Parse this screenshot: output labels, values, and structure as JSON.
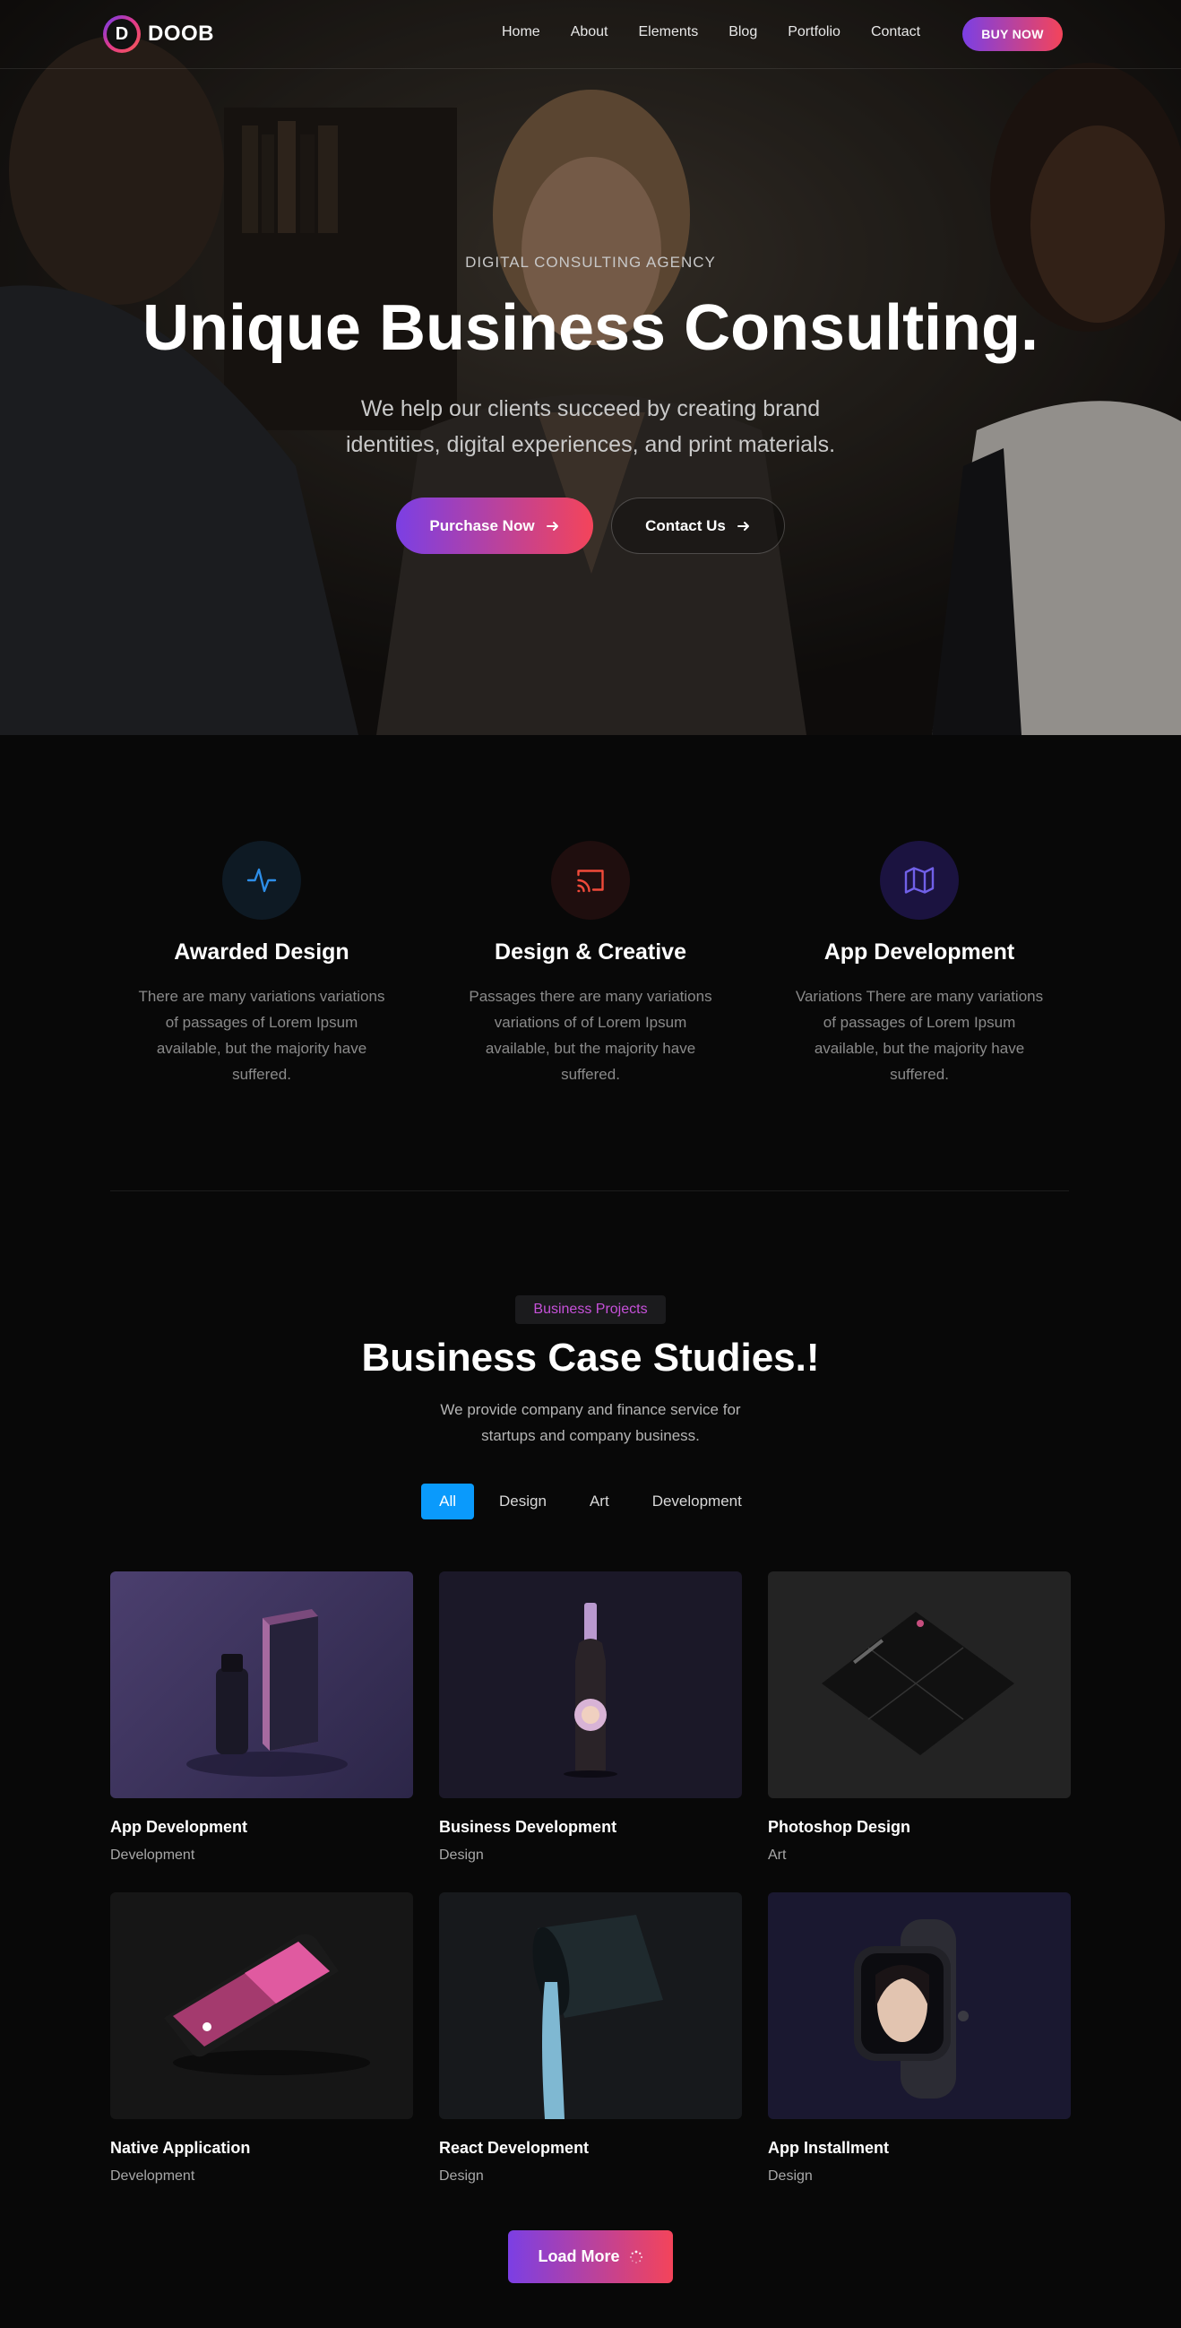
{
  "brand": {
    "logo_letter": "D",
    "name": "DOOB"
  },
  "nav": {
    "items": [
      "Home",
      "About",
      "Elements",
      "Blog",
      "Portfolio",
      "Contact"
    ],
    "cta": "BUY NOW"
  },
  "hero": {
    "subtitle": "DIGITAL CONSULTING AGENCY",
    "title": "Unique Business Consulting.",
    "description": "We help our clients succeed by creating brand identities, digital experiences, and print materials.",
    "primary_button": "Purchase Now",
    "secondary_button": "Contact Us"
  },
  "services": [
    {
      "icon": "activity-icon",
      "title": "Awarded Design",
      "text": "There are many variations variations of passages of Lorem Ipsum available, but the majority have suffered."
    },
    {
      "icon": "cast-icon",
      "title": "Design & Creative",
      "text": "Passages there are many variations variations of of Lorem Ipsum available, but the majority have suffered."
    },
    {
      "icon": "map-icon",
      "title": "App Development",
      "text": "Variations There are many variations of passages of Lorem Ipsum available, but the majority have suffered."
    }
  ],
  "portfolio": {
    "badge": "Business Projects",
    "title": "Business Case Studies.!",
    "description": "We provide company and finance service for startups and company business.",
    "filters": [
      "All",
      "Design",
      "Art",
      "Development"
    ],
    "active_filter": "All",
    "projects": [
      {
        "title": "App Development",
        "category": "Development"
      },
      {
        "title": "Business Development",
        "category": "Design"
      },
      {
        "title": "Photoshop Design",
        "category": "Art"
      },
      {
        "title": "Native Application",
        "category": "Development"
      },
      {
        "title": "React Development",
        "category": "Design"
      },
      {
        "title": "App Installment",
        "category": "Design"
      }
    ],
    "load_more": "Load More"
  },
  "colors": {
    "accent_start": "#7b3fe4",
    "accent_end": "#f4445a",
    "filter_active": "#0a9afc",
    "background": "#080808"
  }
}
